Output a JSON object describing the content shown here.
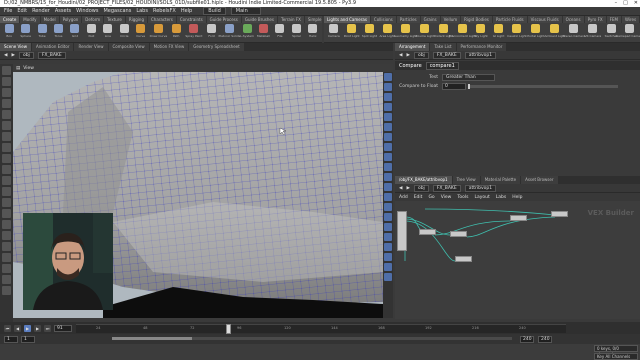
{
  "window": {
    "title": "D:/02_NMBRS/15_for_Houdini/02_PROJECT_FILES/02_HOUDINI/SOLS_01D/subfile01.hiplc - Houdini Indie Limited-Commercial 19.5.805 - Py3.9",
    "controls": [
      "–",
      "□",
      "✕"
    ]
  },
  "menu": {
    "items": [
      "File",
      "Edit",
      "Render",
      "Assets",
      "Windows",
      "Megascans",
      "Labs",
      "RebelsFX",
      "Help"
    ],
    "desktop": "Build",
    "session": "Main"
  },
  "shelf_tabs_left": [
    "Create",
    "Modify",
    "Model",
    "Polygon",
    "Deform",
    "Texture",
    "Rigging",
    "Characters",
    "Constraints",
    "Guide Process",
    "Guide Brushes",
    "Terrain FX",
    "Simple FX",
    "Volume"
  ],
  "shelf_tabs_right": [
    "Lights and Cameras",
    "Collisions",
    "Particles",
    "Grains",
    "Vellum",
    "Rigid Bodies",
    "Particle Fluids",
    "Viscous Fluids",
    "Oceans",
    "Pyro FX",
    "FEM",
    "Wires",
    "Crowds",
    "Drive Simulation"
  ],
  "shelf_tools_left": [
    {
      "label": "Box",
      "icon": "box-icon",
      "color": "#8aa0c8"
    },
    {
      "label": "Sphere",
      "icon": "sphere-icon",
      "color": "#8aa0c8"
    },
    {
      "label": "Tube",
      "icon": "tube-icon",
      "color": "#8aa0c8"
    },
    {
      "label": "Torus",
      "icon": "torus-icon",
      "color": "#8aa0c8"
    },
    {
      "label": "Grid",
      "icon": "grid-icon",
      "color": "#8aa0c8"
    },
    {
      "label": "Null",
      "icon": "null-icon",
      "color": "#c8c8c8"
    },
    {
      "label": "Line",
      "icon": "line-icon",
      "color": "#c8c8c8"
    },
    {
      "label": "Circle",
      "icon": "circle-icon",
      "color": "#c8c8c8"
    },
    {
      "label": "Curve",
      "icon": "curve-icon",
      "color": "#d89a3a"
    },
    {
      "label": "Draw Curve",
      "icon": "draw-curve-icon",
      "color": "#d89a3a"
    },
    {
      "label": "Path",
      "icon": "path-icon",
      "color": "#d89a3a"
    },
    {
      "label": "Spray Paint",
      "icon": "spray-paint-icon",
      "color": "#c45a5a"
    },
    {
      "label": "Font",
      "icon": "font-icon",
      "color": "#c8c8c8"
    },
    {
      "label": "Platonic Solids",
      "icon": "platonic-icon",
      "color": "#8aa0c8"
    },
    {
      "label": "L-System",
      "icon": "lsystem-icon",
      "color": "#6aaa5a"
    },
    {
      "label": "Metaball",
      "icon": "metaball-icon",
      "color": "#c45a5a"
    },
    {
      "label": "File",
      "icon": "file-icon",
      "color": "#c8c8c8"
    },
    {
      "label": "Spiral",
      "icon": "spiral-icon",
      "color": "#c8c8c8"
    },
    {
      "label": "Helix",
      "icon": "helix-icon",
      "color": "#c8c8c8"
    }
  ],
  "shelf_tools_right": [
    {
      "label": "Camera",
      "icon": "camera-icon",
      "color": "#c8c8c8"
    },
    {
      "label": "Point Light",
      "icon": "point-light-icon",
      "color": "#e6c34a"
    },
    {
      "label": "Spot Light",
      "icon": "spot-light-icon",
      "color": "#e6c34a"
    },
    {
      "label": "Area Light",
      "icon": "area-light-icon",
      "color": "#e6c34a"
    },
    {
      "label": "Geometry Light",
      "icon": "geometry-light-icon",
      "color": "#e6c34a"
    },
    {
      "label": "Volume Light",
      "icon": "volume-light-icon",
      "color": "#e6c34a"
    },
    {
      "label": "Distant Light",
      "icon": "distant-light-icon",
      "color": "#e6c34a"
    },
    {
      "label": "Environment Light",
      "icon": "environment-light-icon",
      "color": "#e6c34a"
    },
    {
      "label": "Sky Light",
      "icon": "sky-light-icon",
      "color": "#e6c34a"
    },
    {
      "label": "GI Light",
      "icon": "gi-light-icon",
      "color": "#e6c34a"
    },
    {
      "label": "Caustic Light",
      "icon": "caustic-light-icon",
      "color": "#e6c34a"
    },
    {
      "label": "Portal Light",
      "icon": "portal-light-icon",
      "color": "#e6c34a"
    },
    {
      "label": "Ambient Light",
      "icon": "ambient-light-icon",
      "color": "#e6c34a"
    },
    {
      "label": "Stereo Camera",
      "icon": "stereo-camera-icon",
      "color": "#c8c8c8"
    },
    {
      "label": "VR Camera",
      "icon": "vr-camera-icon",
      "color": "#c8c8c8"
    },
    {
      "label": "Switcher",
      "icon": "switcher-icon",
      "color": "#c8c8c8"
    },
    {
      "label": "Gamepad Camera",
      "icon": "gamepad-camera-icon",
      "color": "#c8c8c8"
    }
  ],
  "pane_tabs_left": [
    "Scene View",
    "Animation Editor",
    "Render View",
    "Composite View",
    "Motion FX View",
    "Geometry Spreadsheet"
  ],
  "pane_tabs_right": [
    "Arrangement",
    "Take List",
    "Performance Monitor"
  ],
  "viewport": {
    "path": [
      "obj",
      "FX_BAKE"
    ],
    "view_label": "View"
  },
  "params": {
    "path": [
      "obj",
      "FX_BAKE",
      "attribvop1"
    ],
    "node_type": "Compare",
    "node_name": "compare1",
    "test_label": "Test",
    "test_value": "Greater Than",
    "compare_label": "Compare to Float",
    "compare_value": "0"
  },
  "network": {
    "tabs": [
      "/obj/FX_BAKE/attribvop1",
      "Tree View",
      "Material Palette",
      "Asset Browser"
    ],
    "path": [
      "obj",
      "FX_BAKE",
      "attribvop1"
    ],
    "menu": [
      "Add",
      "Edit",
      "Go",
      "View",
      "Tools",
      "Layout",
      "Labs",
      "Help"
    ],
    "context_label": "VEX Builder"
  },
  "timeline": {
    "current_frame": "91",
    "ticks": [
      "24",
      "48",
      "72",
      "96",
      "120",
      "144",
      "168",
      "192",
      "216",
      "240"
    ],
    "range_start": "1",
    "range_start2": "1",
    "range_end": "240",
    "range_end2": "240",
    "status1": "0 keys, 0/0 channels",
    "status2": "Key All Channels"
  }
}
